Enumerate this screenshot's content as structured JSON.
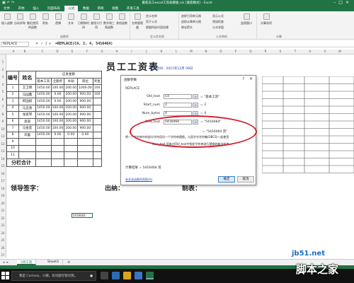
{
  "window": {
    "title": "最新员工excel工资表模板.xls [兼容模式] - Excel"
  },
  "ribbon_tabs": [
    "文件",
    "开始",
    "插入",
    "页面布局",
    "公式",
    "数据",
    "审阅",
    "视图",
    "开发工具"
  ],
  "ribbon": {
    "insert_function": "插入函数",
    "autosum": "自动求和",
    "recent": "最近使用的函数",
    "financial": "财务",
    "logical": "逻辑",
    "text": "文本",
    "datetime": "日期和时间",
    "lookup": "查找与引用",
    "math": "数学和三角函数",
    "more": "其他函数",
    "name_mgr": "名称管理器",
    "define_name": "定义名称",
    "use_in_formula": "用于公式",
    "create_from_sel": "根据所选内容创建",
    "trace_precedents": "追踪引用单元格",
    "trace_dependents": "追踪从属单元格",
    "remove_arrows": "移去箭头",
    "show_formulas": "显示公式",
    "error_check": "错误检查",
    "evaluate": "公式求值",
    "watch": "监视窗口",
    "calc_options": "计算选项",
    "group_lib": "函数库",
    "group_names": "定义的名称",
    "group_audit": "公式审核",
    "group_calc": "计算"
  },
  "formula_bar": {
    "name_box": "REPLACE",
    "formula": "=REPLACE(C4, 2, 4, 5416464)"
  },
  "columns": [
    "A",
    "B",
    "C",
    "D",
    "E",
    "F",
    "G",
    "H",
    "I",
    "J",
    "K",
    "L",
    "M",
    "N",
    "O",
    "P",
    "Q",
    "R",
    "S",
    "T",
    "U",
    "V",
    "W"
  ],
  "rows": [
    "1",
    "2",
    "3",
    "4",
    "5",
    "6",
    "7",
    "8",
    "9",
    "10",
    "11",
    "12",
    "13",
    "14",
    "15",
    "16",
    "17",
    "18",
    "19",
    "20",
    "21",
    "22",
    "23",
    "24",
    "25",
    "26",
    "27"
  ],
  "sheet": {
    "title": "员工工资表",
    "date_text": "制表时间：2015年12月 09日",
    "hdr_no": "编号",
    "hdr_name": "姓名",
    "hdr_pay": "应发金额",
    "sub": [
      "基本工资",
      "全勤奖",
      "补助",
      "岗位",
      "奖金"
    ],
    "employees": [
      {
        "no": "1",
        "name": "王卫明",
        "v": [
          "1450.00",
          "100.00",
          "200.00",
          "1000.00",
          "100"
        ]
      },
      {
        "no": "2",
        "name": "马国鑫",
        "v": [
          "1450.00",
          "0.00",
          "200.00",
          "900.00",
          "100"
        ]
      },
      {
        "no": "3",
        "name": "郎国斌",
        "v": [
          "1450.00",
          "0.00",
          "200.00",
          "900.00",
          ""
        ]
      },
      {
        "no": "4",
        "name": "马丑香",
        "v": [
          "1450.00",
          "100.00",
          "200.00",
          "900.00",
          ""
        ]
      },
      {
        "no": "5",
        "name": "张爱琴",
        "v": [
          "1450.00",
          "100.00",
          "200.00",
          "900.00",
          ""
        ]
      },
      {
        "no": "6",
        "name": "高丽",
        "v": [
          "1450.00",
          "100.00",
          "200.00",
          "900.00",
          ""
        ]
      },
      {
        "no": "7",
        "name": "马金莲",
        "v": [
          "1450.00",
          "100.00",
          "200.00",
          "900.00",
          ""
        ]
      },
      {
        "no": "8",
        "name": "邓蕾",
        "v": [
          "1450.00",
          "0.00",
          "0.00",
          "0.00",
          ""
        ]
      },
      {
        "no": "9",
        "name": "",
        "v": [
          "",
          "",
          "",
          "",
          ""
        ]
      },
      {
        "no": "10",
        "name": "",
        "v": [
          "",
          "",
          "",
          "",
          ""
        ]
      },
      {
        "no": "11",
        "name": "",
        "v": [
          "",
          "",
          "",
          "",
          ""
        ]
      }
    ],
    "subtotal": "分栏合计",
    "leader": "领导签字：",
    "cashier": "出纳：",
    "maker": "制表：",
    "output_cell": "5416464"
  },
  "dialog": {
    "title": "函数参数",
    "help": "?",
    "close": "×",
    "function": "REPLACE",
    "args": [
      {
        "label": "Old_text",
        "value": "C4",
        "result": "= \"基本工资\""
      },
      {
        "label": "Start_num",
        "value": "2",
        "result": "= 2"
      },
      {
        "label": "Num_bytes",
        "value": "4",
        "result": "= 4"
      },
      {
        "label": "New_text",
        "value": "5416464",
        "result": "= \"5416464\""
      }
    ],
    "result_all": "= \"5416464 资\"",
    "desc1": "将一个字符串中的部分字符用另一个字符串替换。与双字节字符集(DBCS)一起使用",
    "desc2": "New_text  用来对Old_text中指定字符串进行替换的新字符串",
    "calc_result": "计算结果 =   5416464 资",
    "help_link": "有关该函数的帮助(H)",
    "ok": "确定",
    "cancel": "取消"
  },
  "sheet_tabs": {
    "tabs": [
      "5月工资",
      "Sheet3"
    ],
    "add": "⊕"
  },
  "taskbar": {
    "search": "我是 Cortana，小娜。有问题尽管问我。"
  },
  "watermark": {
    "site": "jb51.net",
    "brand": "脚本之家"
  },
  "colors": {
    "excel_green": "#217346",
    "circle_red": "#d21f2a"
  }
}
